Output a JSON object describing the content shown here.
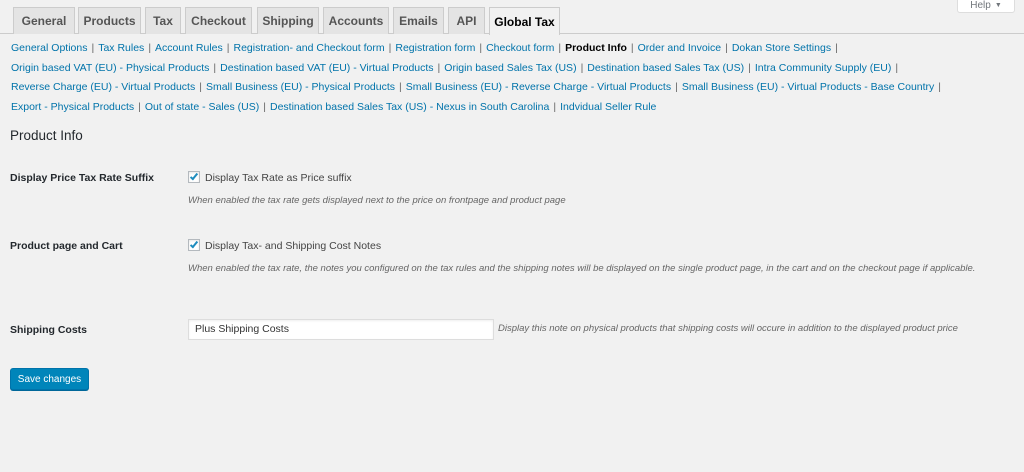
{
  "help": {
    "label": "Help",
    "caret": "▼"
  },
  "tabs": [
    {
      "label": "General"
    },
    {
      "label": "Products"
    },
    {
      "label": "Tax"
    },
    {
      "label": "Checkout"
    },
    {
      "label": "Shipping"
    },
    {
      "label": "Accounts"
    },
    {
      "label": "Emails"
    },
    {
      "label": "API"
    },
    {
      "label": "Global Tax",
      "active": true
    }
  ],
  "sections": [
    [
      {
        "label": "General Options"
      },
      {
        "label": "Tax Rules"
      },
      {
        "label": "Account Rules"
      },
      {
        "label": "Registration- and Checkout form"
      },
      {
        "label": "Registration form"
      },
      {
        "label": "Checkout form"
      },
      {
        "label": "Product Info",
        "current": true
      },
      {
        "label": "Order and Invoice"
      },
      {
        "label": "Dokan Store Settings"
      }
    ],
    [
      {
        "label": "Origin based VAT (EU) - Physical Products"
      },
      {
        "label": "Destination based VAT (EU) - Virtual Products"
      },
      {
        "label": "Origin based Sales Tax (US)"
      },
      {
        "label": "Destination based Sales Tax (US)"
      },
      {
        "label": "Intra Community Supply (EU)"
      }
    ],
    [
      {
        "label": "Reverse Charge (EU) - Virtual Products"
      },
      {
        "label": "Small Business (EU) - Physical Products"
      },
      {
        "label": "Small Business (EU) - Reverse Charge - Virtual Products"
      },
      {
        "label": "Small Business (EU) - Virtual Products - Base Country"
      }
    ],
    [
      {
        "label": "Export - Physical Products"
      },
      {
        "label": "Out of state - Sales (US)"
      },
      {
        "label": "Destination based Sales Tax (US) - Nexus in South Carolina"
      },
      {
        "label": "Indvidual Seller Rule"
      }
    ]
  ],
  "page": {
    "title": "Product Info"
  },
  "settings": {
    "price_suffix": {
      "label": "Display Price Tax Rate Suffix",
      "checkbox_label": "Display Tax Rate as Price suffix",
      "checked": true,
      "description": "When enabled the tax rate gets displayed next to the price on frontpage and product page"
    },
    "cart_notes": {
      "label": "Product page and Cart",
      "checkbox_label": "Display Tax- and Shipping Cost Notes",
      "checked": true,
      "description": "When enabled the tax rate, the notes you configured on the tax rules and the shipping notes will be displayed on the single product page, in the cart and on the checkout page if applicable."
    },
    "shipping_costs": {
      "label": "Shipping Costs",
      "value": "Plus Shipping Costs",
      "description": "Display this note on physical products that shipping costs will occure in addition to the displayed product price"
    }
  },
  "actions": {
    "save_label": "Save changes"
  },
  "colors": {
    "link": "#0073aa",
    "button": "#0085ba",
    "background": "#f1f1f1"
  }
}
